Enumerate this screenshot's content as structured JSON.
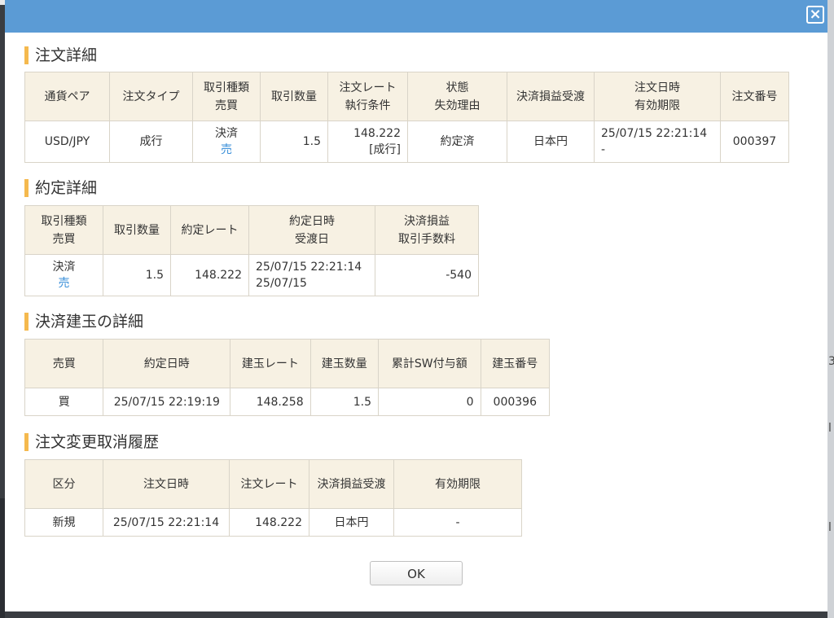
{
  "dialog": {
    "close_label": "×",
    "ok_label": "OK"
  },
  "order_detail": {
    "title": "注文詳細",
    "headers": [
      [
        "通貨ペア"
      ],
      [
        "注文タイプ"
      ],
      [
        "取引種類",
        "売買"
      ],
      [
        "取引数量"
      ],
      [
        "注文レート",
        "執行条件"
      ],
      [
        "状態",
        "失効理由"
      ],
      [
        "決済損益受渡"
      ],
      [
        "注文日時",
        "有効期限"
      ],
      [
        "注文番号"
      ]
    ],
    "row": {
      "pair": "USD/JPY",
      "order_type": "成行",
      "trade_kind": "決済",
      "side": "売",
      "quantity": "1.5",
      "rate": "148.222",
      "condition": "[成行]",
      "status": "約定済",
      "settlement": "日本円",
      "order_datetime": "25/07/15 22:21:14",
      "expiry": "-",
      "order_no": "000397"
    }
  },
  "execution_detail": {
    "title": "約定詳細",
    "headers": [
      [
        "取引種類",
        "売買"
      ],
      [
        "取引数量"
      ],
      [
        "約定レート"
      ],
      [
        "約定日時",
        "受渡日"
      ],
      [
        "決済損益",
        "取引手数料"
      ]
    ],
    "row": {
      "trade_kind": "決済",
      "side": "売",
      "quantity": "1.5",
      "rate": "148.222",
      "exec_datetime": "25/07/15 22:21:14",
      "delivery_date": "25/07/15",
      "pnl": "-540"
    }
  },
  "position_detail": {
    "title": "決済建玉の詳細",
    "headers": [
      "売買",
      "約定日時",
      "建玉レート",
      "建玉数量",
      "累計SW付与額",
      "建玉番号"
    ],
    "row": {
      "side": "買",
      "exec_datetime": "25/07/15 22:19:19",
      "rate": "148.258",
      "quantity": "1.5",
      "swap_total": "0",
      "position_no": "000396"
    }
  },
  "change_history": {
    "title": "注文変更取消履歴",
    "headers": [
      "区分",
      "注文日時",
      "注文レート",
      "決済損益受渡",
      "有効期限"
    ],
    "row": {
      "category": "新規",
      "order_datetime": "25/07/15 22:21:14",
      "rate": "148.222",
      "settlement": "日本円",
      "expiry": "-"
    }
  },
  "background": {
    "right_marks": [
      "3",
      "l",
      "l"
    ]
  },
  "colors": {
    "header_bar": "#5b9bd5",
    "section_accent": "#f5b94e",
    "table_header_bg": "#f7f1e3",
    "sell": "#3a8fd9",
    "buy": "#d9432f",
    "negative": "#d9432f"
  }
}
